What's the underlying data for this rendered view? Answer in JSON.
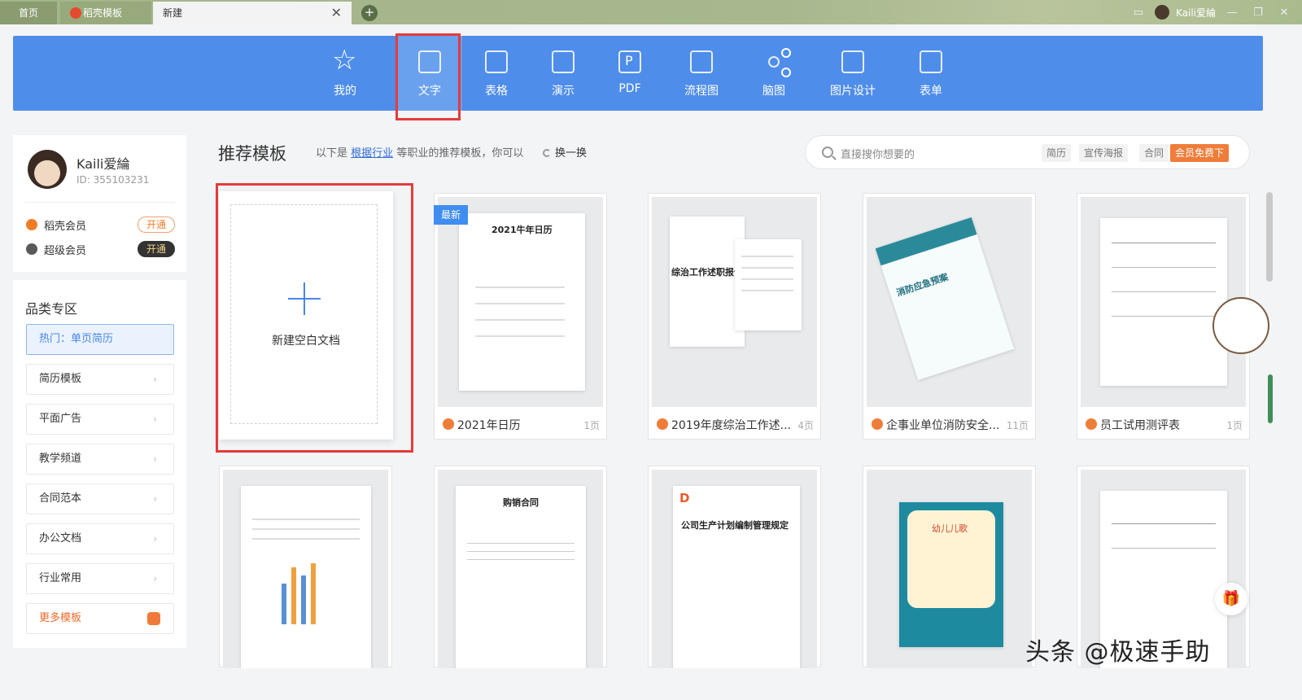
{
  "tabs": [
    {
      "label": "首页"
    },
    {
      "label": "稻壳模板"
    },
    {
      "label": "新建"
    }
  ],
  "titlebar": {
    "user": "Kaili爱綸"
  },
  "categories": [
    {
      "label": "我的",
      "icon": "star-icon"
    },
    {
      "label": "文字",
      "icon": "document-icon"
    },
    {
      "label": "表格",
      "icon": "table-icon"
    },
    {
      "label": "演示",
      "icon": "presentation-icon"
    },
    {
      "label": "PDF",
      "icon": "pdf-icon"
    },
    {
      "label": "流程图",
      "icon": "flowchart-icon"
    },
    {
      "label": "脑图",
      "icon": "mindmap-icon"
    },
    {
      "label": "图片设计",
      "icon": "image-design-icon"
    },
    {
      "label": "表单",
      "icon": "form-icon"
    }
  ],
  "user": {
    "name": "Kaili爱綸",
    "id": "ID: 355103231",
    "memberships": [
      {
        "label": "稻壳会员",
        "action": "开通"
      },
      {
        "label": "超级会员",
        "action": "开通"
      }
    ]
  },
  "category_zone": {
    "title": "品类专区",
    "items": [
      {
        "label": "热门：单页简历"
      },
      {
        "label": "简历模板"
      },
      {
        "label": "平面广告"
      },
      {
        "label": "教学频道"
      },
      {
        "label": "合同范本"
      },
      {
        "label": "办公文档"
      },
      {
        "label": "行业常用"
      },
      {
        "label": "更多模板"
      }
    ]
  },
  "main": {
    "title": "推荐模板",
    "desc_prefix": "以下是",
    "desc_link": "根据行业",
    "desc_suffix": "等职业的推荐模板，你可以",
    "swap": "换一换",
    "blank_doc": "新建空白文档",
    "new_badge": "最新"
  },
  "search": {
    "placeholder": "直接搜你想要的",
    "tags": [
      "简历",
      "宣传海报",
      "合同"
    ],
    "vip_tag": "会员免费下"
  },
  "cards": [
    {
      "name": "2021年日历",
      "pages": "1页",
      "preview_title": "2021牛年日历"
    },
    {
      "name": "2019年度综治工作述...",
      "pages": "4页",
      "preview_title": "综治工作述职报告"
    },
    {
      "name": "企事业单位消防安全...",
      "pages": "11页",
      "preview_title": "消防应急预案"
    },
    {
      "name": "员工试用测评表",
      "pages": "1页",
      "preview_title": ""
    }
  ],
  "cards_row2": [
    {
      "preview_title": ""
    },
    {
      "preview_title": "购销合同"
    },
    {
      "preview_title": "公司生产计划编制管理规定"
    },
    {
      "preview_title": "幼儿儿歌"
    },
    {
      "preview_title": ""
    }
  ],
  "watermark": "头条 @极速手助",
  "colors": {
    "brand_blue": "#4f8dea",
    "highlight_red": "#e53b3b",
    "accent_orange": "#ef7d3a"
  }
}
